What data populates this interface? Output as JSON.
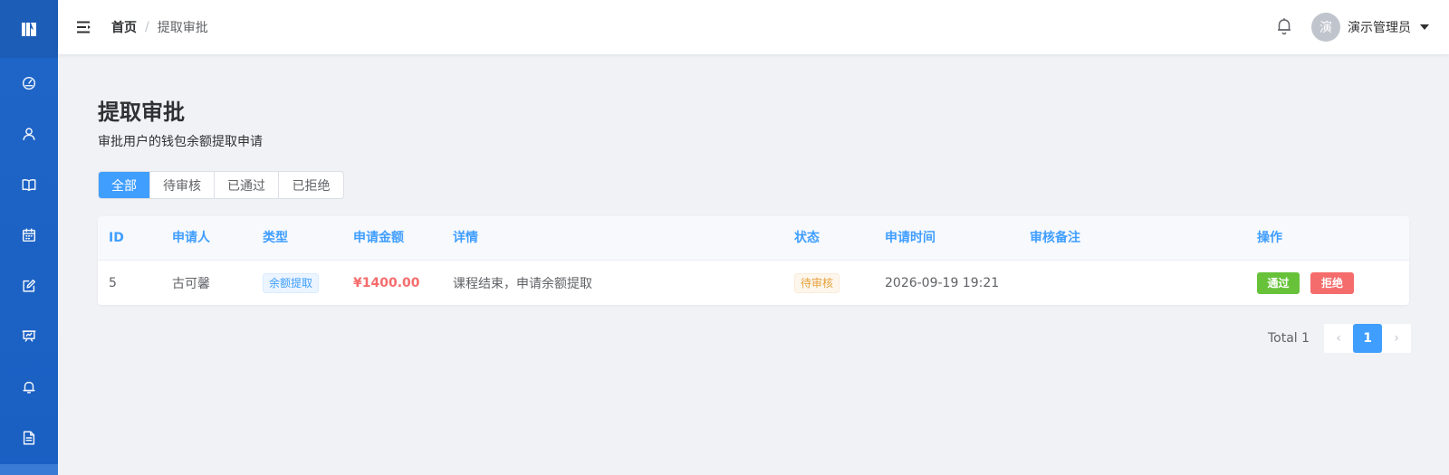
{
  "sidebar": {
    "items": [
      {
        "icon": "dashboard-icon"
      },
      {
        "icon": "user-icon"
      },
      {
        "icon": "book-icon"
      },
      {
        "icon": "calendar-icon"
      },
      {
        "icon": "edit-icon"
      },
      {
        "icon": "presentation-icon"
      },
      {
        "icon": "bell-icon"
      },
      {
        "icon": "document-icon"
      }
    ]
  },
  "header": {
    "breadcrumb_home": "首页",
    "breadcrumb_sep": "/",
    "breadcrumb_current": "提取审批",
    "avatar_text": "演",
    "username": "演示管理员"
  },
  "page": {
    "title": "提取审批",
    "subtitle": "审批用户的钱包余额提取申请"
  },
  "tabs": [
    "全部",
    "待审核",
    "已通过",
    "已拒绝"
  ],
  "table": {
    "columns": [
      "ID",
      "申请人",
      "类型",
      "申请金额",
      "详情",
      "状态",
      "申请时间",
      "审核备注",
      "操作"
    ],
    "rows": [
      {
        "id": "5",
        "applicant": "古可馨",
        "type": "余额提取",
        "amount": "¥1400.00",
        "detail": "课程结束，申请余额提取",
        "status": "待审核",
        "time": "2026-09-19 19:21",
        "remark": "",
        "approve": "通过",
        "reject": "拒绝"
      }
    ]
  },
  "pagination": {
    "total_label": "Total 1",
    "prev": "‹",
    "current": "1",
    "next": "›"
  },
  "colors": {
    "sidebar": "#1f66c8",
    "primary": "#409eff",
    "success": "#67c23a",
    "danger": "#f56c6c",
    "warning": "#e6a23c"
  }
}
